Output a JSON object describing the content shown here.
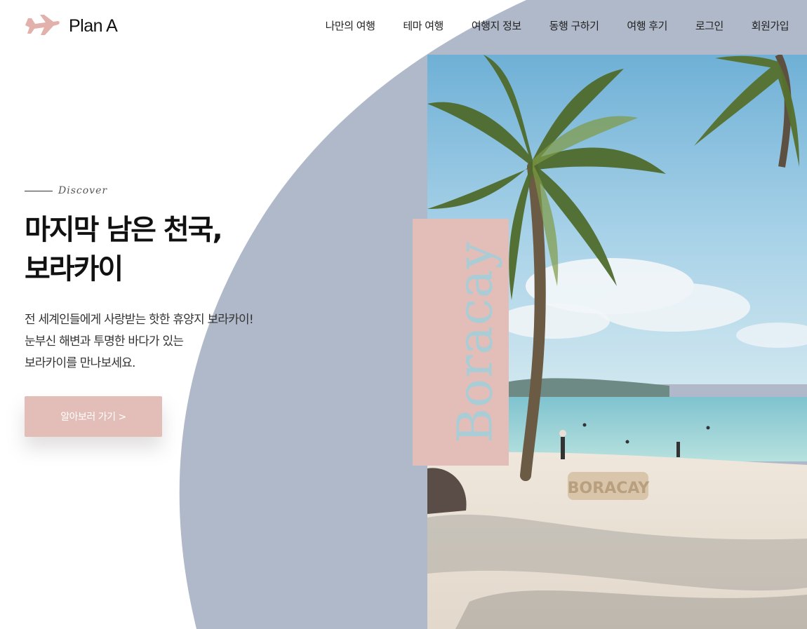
{
  "brand": {
    "name": "Plan A",
    "icon": "airplane-icon"
  },
  "nav": {
    "items": [
      "나만의 여행",
      "테마 여행",
      "여행지 정보",
      "동행 구하기",
      "여행 후기",
      "로그인",
      "회원가입"
    ]
  },
  "hero": {
    "eyebrow": "Discover",
    "title_line1": "마지막 남은 천국,",
    "title_line2": "보라카이",
    "desc_line1": "전 세계인들에게 사랑받는 핫한 휴양지 보라카이!",
    "desc_line2": "눈부신 해변과 투명한 바다가 있는",
    "desc_line3": "보라카이를 만나보세요.",
    "cta_label": "알아보러 가기 >",
    "vertical_label": "Boracay",
    "photo_sign": "BORACAY"
  },
  "colors": {
    "accent_pink": "#e3bdb7",
    "shape_bluegray": "#b0b9c9",
    "text_dark": "#111111"
  }
}
